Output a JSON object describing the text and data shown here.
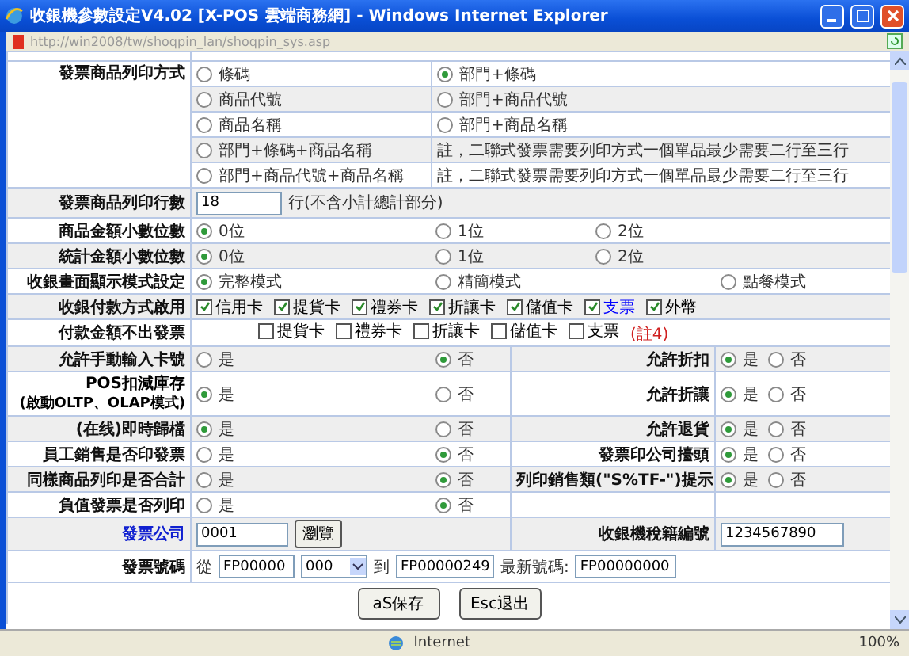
{
  "window": {
    "title": "收銀機參數設定V4.02 [X-POS 雲端商務網] - Windows Internet Explorer",
    "address": "http://win2008/tw/shoqpin_lan/shoqpin_sys.asp"
  },
  "print_method": {
    "label": "發票商品列印方式",
    "rows": [
      {
        "left": {
          "label": "條碼",
          "selected": false
        },
        "right": {
          "kind": "option",
          "label": "部門+條碼",
          "selected": true
        }
      },
      {
        "left": {
          "label": "商品代號",
          "selected": false
        },
        "right": {
          "kind": "option",
          "label": "部門+商品代號",
          "selected": false
        }
      },
      {
        "left": {
          "label": "商品名稱",
          "selected": false
        },
        "right": {
          "kind": "option",
          "label": "部門+商品名稱",
          "selected": false
        }
      },
      {
        "left": {
          "label": "部門+條碼+商品名稱",
          "selected": false
        },
        "right": {
          "kind": "note",
          "text": "註，二聯式發票需要列印方式一個單品最少需要二行至三行"
        }
      },
      {
        "left": {
          "label": "部門+商品代號+商品名稱",
          "selected": false
        },
        "right": {
          "kind": "note",
          "text": "註，二聯式發票需要列印方式一個單品最少需要二行至三行"
        }
      }
    ]
  },
  "lines_row": {
    "label": "發票商品列印行數",
    "value": "18",
    "suffix": "行(不含小計總計部分)"
  },
  "settings": [
    {
      "kind": "radio",
      "label": "商品金額小數位數",
      "options": [
        {
          "label": "0位",
          "selected": true
        },
        {
          "label": "1位",
          "selected": false
        },
        {
          "label": "2位",
          "selected": false
        }
      ]
    },
    {
      "kind": "radio",
      "label": "統計金額小數位數",
      "options": [
        {
          "label": "0位",
          "selected": true
        },
        {
          "label": "1位",
          "selected": false
        },
        {
          "label": "2位",
          "selected": false
        }
      ]
    },
    {
      "kind": "mode",
      "label": "收銀畫面顯示模式設定",
      "options": [
        {
          "label": "完整模式",
          "selected": true
        },
        {
          "label": "精簡模式",
          "selected": false
        },
        {
          "label": "點餐模式",
          "selected": false
        }
      ]
    },
    {
      "kind": "checks",
      "label": "收銀付款方式啟用",
      "items": [
        {
          "label": "信用卡",
          "checked": true,
          "color": "#000000"
        },
        {
          "label": "提貨卡",
          "checked": true,
          "color": "#000000"
        },
        {
          "label": "禮券卡",
          "checked": true,
          "color": "#000000"
        },
        {
          "label": "折讓卡",
          "checked": true,
          "color": "#000000"
        },
        {
          "label": "儲值卡",
          "checked": true,
          "color": "#000000"
        },
        {
          "label": "支票",
          "checked": true,
          "color": "#0000ff"
        },
        {
          "label": "外幣",
          "checked": true,
          "color": "#000000"
        }
      ]
    },
    {
      "kind": "indented",
      "label": "付款金額不出發票",
      "items": [
        {
          "label": "提貨卡",
          "checked": false,
          "color": "#000000"
        },
        {
          "label": "禮券卡",
          "checked": false,
          "color": "#000000"
        },
        {
          "label": "折讓卡",
          "checked": false,
          "color": "#000000"
        },
        {
          "label": "儲值卡",
          "checked": false,
          "color": "#000000"
        },
        {
          "label": "支票",
          "checked": false,
          "color": "#000000"
        }
      ],
      "note": "(註4)"
    },
    {
      "kind": "pair",
      "label": "允許手動輸入卡號",
      "options": [
        {
          "label": "是",
          "selected": false
        },
        {
          "label": "否",
          "selected": true
        }
      ],
      "right": {
        "label": "允許折扣",
        "options": [
          {
            "label": "是",
            "selected": true
          },
          {
            "label": "否",
            "selected": false
          }
        ]
      }
    },
    {
      "kind": "pair",
      "label": "POS扣減庫存",
      "label_2": "(啟動OLTP、OLAP模式)",
      "options": [
        {
          "label": "是",
          "selected": true
        },
        {
          "label": "否",
          "selected": false
        }
      ],
      "right": {
        "label": "允許折讓",
        "options": [
          {
            "label": "是",
            "selected": true
          },
          {
            "label": "否",
            "selected": false
          }
        ]
      }
    },
    {
      "kind": "pair",
      "label": "(在线)即時歸檔",
      "options": [
        {
          "label": "是",
          "selected": true
        },
        {
          "label": "否",
          "selected": false
        }
      ],
      "right": {
        "label": "允許退貨",
        "options": [
          {
            "label": "是",
            "selected": true
          },
          {
            "label": "否",
            "selected": false
          }
        ]
      }
    },
    {
      "kind": "pair",
      "label": "員工銷售是否印發票",
      "options": [
        {
          "label": "是",
          "selected": false
        },
        {
          "label": "否",
          "selected": true
        }
      ],
      "right": {
        "label": "發票印公司擡頭",
        "options": [
          {
            "label": "是",
            "selected": true
          },
          {
            "label": "否",
            "selected": false
          }
        ]
      }
    },
    {
      "kind": "pair",
      "label": "同樣商品列印是否合計",
      "options": [
        {
          "label": "是",
          "selected": false
        },
        {
          "label": "否",
          "selected": true
        }
      ],
      "right": {
        "label": "列印銷售類(\"S%TF-\")提示",
        "options": [
          {
            "label": "是",
            "selected": true
          },
          {
            "label": "否",
            "selected": false
          }
        ]
      }
    },
    {
      "kind": "pair",
      "label": "負值發票是否列印",
      "options": [
        {
          "label": "是",
          "selected": false
        },
        {
          "label": "否",
          "selected": true
        }
      ]
    }
  ],
  "company": {
    "label": "發票公司",
    "value": "0001",
    "button": "瀏覽",
    "right_label": "收銀機稅籍編號",
    "right_value": "1234567890"
  },
  "invoice": {
    "label": "發票號碼",
    "from_label": "從",
    "from": "FP00000",
    "select": "000",
    "to_label": "到",
    "to": "FP00000249",
    "latest_label": "最新號碼:",
    "latest": "FP00000000"
  },
  "buttons": [
    "aS保存",
    "Esc退出"
  ],
  "status_bar": {
    "zone": "Internet",
    "zoom": "100%"
  }
}
